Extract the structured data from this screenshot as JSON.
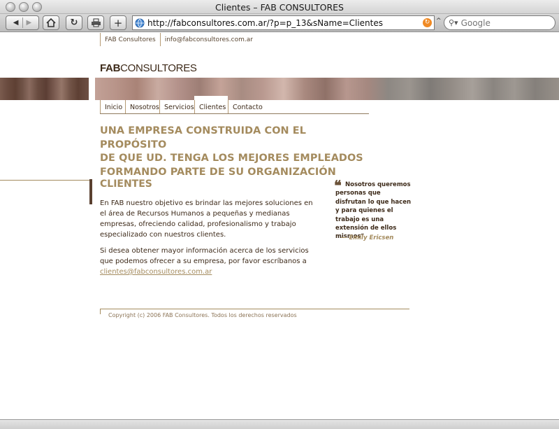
{
  "window": {
    "title": "Clientes – FAB CONSULTORES"
  },
  "toolbar": {
    "url": "http://fabconsultores.com.ar/?p=p_13&sName=Clientes",
    "search_placeholder": "Google"
  },
  "site": {
    "top_links": [
      "FAB Consultores",
      "info@fabconsultores.com.ar"
    ],
    "logo_bold": "FAB",
    "logo_rest": "CONSULTORES",
    "nav": [
      "Inicio",
      "Nosotros",
      "Servicios",
      "Clientes",
      "Contacto"
    ],
    "active_nav": "Clientes",
    "headline_lines": [
      "UNA EMPRESA CONSTRUIDA CON EL PROPÓSITO",
      "DE QUE UD. TENGA LOS MEJORES EMPLEADOS",
      "FORMANDO PARTE DE SU ORGANIZACIÓN"
    ],
    "section_title": "CLIENTES",
    "paragraph1": "En FAB nuestro objetivo es brindar las mejores soluciones en el área de Recursos Humanos a pequeñas y medianas empresas, ofreciendo calidad, profesionalismo y trabajo especializado con nuestros clientes.",
    "paragraph2": "Si desea obtener mayor información acerca de los servicios que podemos ofrecer a su empresa, por favor escríbanos a",
    "email_link": "clientes@fabconsultores.com.ar",
    "quote_text": "Nosotros queremos personas que disfrutan lo que hacen y para quienes el trabajo es una extensión de ellos mismos\"",
    "quote_author": "— Emily Ericsen",
    "copyright": "Copyright (c) 2006 FAB Consultores. Todos los derechos reservados"
  }
}
